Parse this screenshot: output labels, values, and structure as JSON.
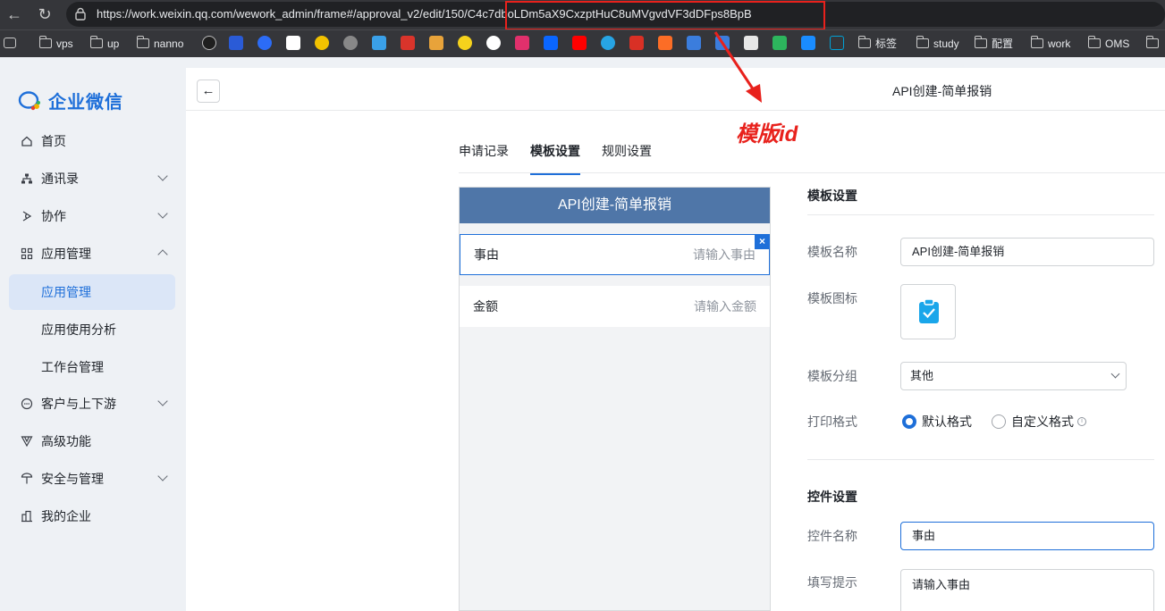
{
  "browser": {
    "url": "https://work.weixin.qq.com/wework_admin/frame#/approval_v2/edit/150/C4c7dboLDm5aX9CxzptHuC8uMVgvdVF3dDFps8BpB",
    "bookmarks": [
      "vps",
      "up",
      "nanno",
      "标签",
      "study",
      "配置",
      "work",
      "OMS"
    ]
  },
  "annotation": {
    "text": "模版id",
    "color": "#e8211c"
  },
  "sidebar": {
    "logo_text": "企业微信",
    "items": [
      {
        "label": "首页",
        "icon": "home-icon"
      },
      {
        "label": "通讯录",
        "icon": "org-chart-icon",
        "expandable": true
      },
      {
        "label": "协作",
        "icon": "collab-icon",
        "expandable": true
      },
      {
        "label": "应用管理",
        "icon": "apps-icon",
        "expanded": true
      },
      {
        "label": "应用管理",
        "sub": true,
        "active": true
      },
      {
        "label": "应用使用分析",
        "sub": true
      },
      {
        "label": "工作台管理",
        "sub": true
      },
      {
        "label": "客户与上下游",
        "icon": "chat-icon",
        "expandable": true
      },
      {
        "label": "高级功能",
        "icon": "filter-icon"
      },
      {
        "label": "安全与管理",
        "icon": "shield-icon",
        "expandable": true
      },
      {
        "label": "我的企业",
        "icon": "building-icon"
      }
    ]
  },
  "header": {
    "title": "API创建-简单报销"
  },
  "tabs": [
    "申请记录",
    "模板设置",
    "规则设置"
  ],
  "active_tab": "模板设置",
  "preview": {
    "title": "API创建-简单报销",
    "fields": [
      {
        "label": "事由",
        "placeholder": "请输入事由",
        "selected": true
      },
      {
        "label": "金额",
        "placeholder": "请输入金额"
      }
    ],
    "delete_glyph": "×"
  },
  "template_settings": {
    "section_title": "模板设置",
    "name_label": "模板名称",
    "name_value": "API创建-简单报销",
    "icon_label": "模板图标",
    "icon_name": "clipboard-check-icon",
    "group_label": "模板分组",
    "group_value": "其他",
    "print_label": "打印格式",
    "print_options": [
      "默认格式",
      "自定义格式"
    ],
    "print_selected": "默认格式"
  },
  "control_settings": {
    "section_title": "控件设置",
    "name_label": "控件名称",
    "name_value": "事由",
    "hint_label": "填写提示",
    "hint_value": "请输入事由"
  },
  "colors": {
    "accent": "#1e6fd9",
    "preview_header": "#4f76a8",
    "icon_cyan": "#1aa6ea"
  }
}
